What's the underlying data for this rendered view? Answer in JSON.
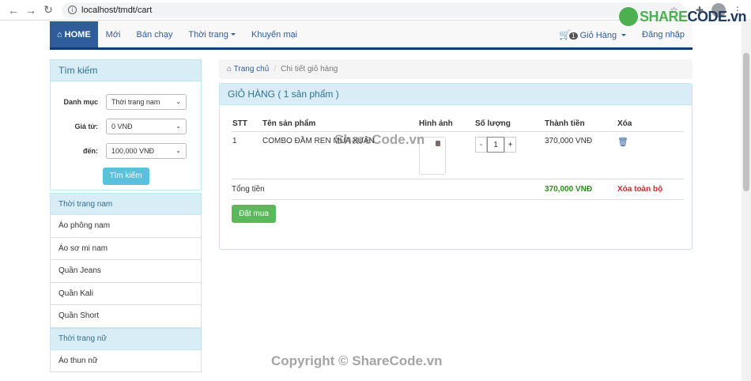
{
  "browser": {
    "url": "localhost/tmdt/cart"
  },
  "navbar": {
    "home": "HOME",
    "items": [
      "Mới",
      "Bán chạy",
      "Thời trang",
      "Khuyến mại"
    ],
    "cart_count": "1",
    "cart_label": "Giỏ Hàng",
    "login": "Đăng nhập"
  },
  "search": {
    "title": "Tìm kiếm",
    "category_label": "Danh mục",
    "category_value": "Thời trang nam",
    "from_label": "Giá từ:",
    "from_value": "0 VNĐ",
    "to_label": "đến:",
    "to_value": "100,000 VNĐ",
    "button": "Tìm kiếm"
  },
  "categories": [
    {
      "title": "Thời trang nam",
      "items": [
        "Áo phông nam",
        "Áo sơ mi nam",
        "Quần Jeans",
        "Quần Kali",
        "Quần Short"
      ]
    },
    {
      "title": "Thời trang nữ",
      "items": [
        "Áo thun nữ"
      ]
    }
  ],
  "breadcrumb": {
    "home": "Trang chủ",
    "current": "Chi tiết giỏ hàng"
  },
  "cart": {
    "title": "GIỎ HÀNG ( 1 sản phẩm )",
    "headers": [
      "STT",
      "Tên sản phẩm",
      "Hình ảnh",
      "Số lượng",
      "Thành tiền",
      "Xóa"
    ],
    "rows": [
      {
        "stt": "1",
        "name": "COMBO ĐẦM REN MÙA XUÂN",
        "qty": "1",
        "price": "370,000 VNĐ"
      }
    ],
    "total_label": "Tổng tiền",
    "total_value": "370,000 VNĐ",
    "clear_all": "Xóa toàn bộ",
    "order_button": "Đặt mua"
  },
  "watermarks": {
    "logo_a": "SHARE",
    "logo_b": "CODE.vn",
    "center": "ShareCode.vn",
    "copyright": "Copyright © ShareCode.vn"
  },
  "icons": {
    "back": "arrow-left-icon",
    "forward": "arrow-right-icon",
    "reload": "reload-icon",
    "cart": "cart-icon",
    "trash": "trash-icon"
  }
}
